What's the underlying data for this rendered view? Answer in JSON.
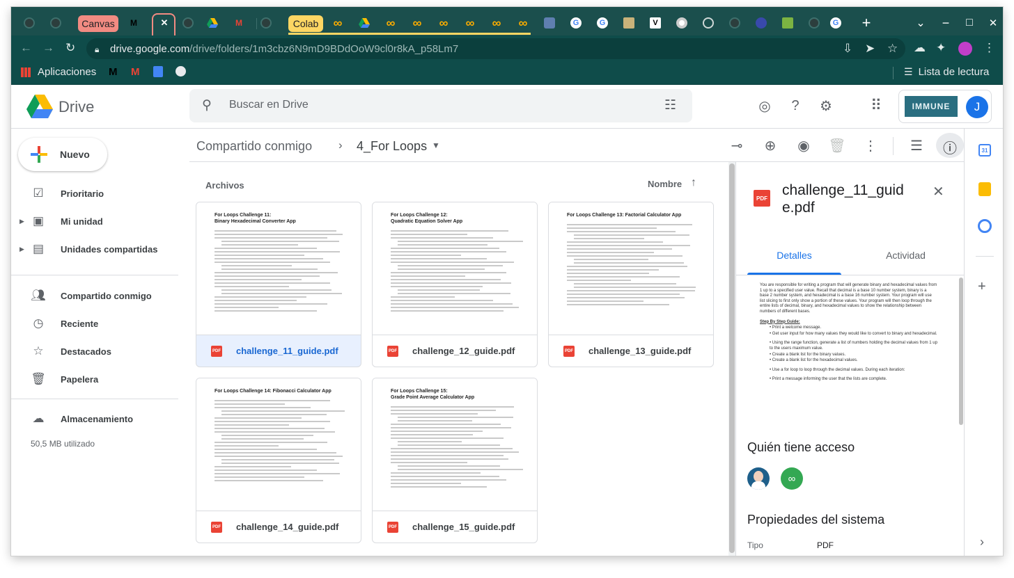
{
  "tabs": {
    "canvas_label": "Canvas",
    "colab_label": "Colab",
    "new_tab": "+",
    "menu": "⌄",
    "minimize": "−",
    "maximize": "□",
    "close": "✕"
  },
  "toolbar": {
    "url_host": "drive.google.com",
    "url_path": "/drive/folders/1m3cbz6N9mD9BDdOoW9cl0r8kA_p58Lm7"
  },
  "bookmarks": {
    "apps_label": "Aplicaciones",
    "reading_list": "Lista de lectura"
  },
  "drive": {
    "logo_text": "Drive",
    "search_placeholder": "Buscar en Drive",
    "avatar_letter": "J",
    "org_logo_text": "IMMUNE"
  },
  "sidebar": {
    "new_button": "Nuevo",
    "items": [
      {
        "label": "Prioritario"
      },
      {
        "label": "Mi unidad"
      },
      {
        "label": "Unidades compartidas"
      },
      {
        "label": "Compartido conmigo"
      },
      {
        "label": "Reciente"
      },
      {
        "label": "Destacados"
      },
      {
        "label": "Papelera"
      },
      {
        "label": "Almacenamiento"
      }
    ],
    "storage_used": "50,5 MB utilizado"
  },
  "breadcrumb": {
    "parent": "Compartido conmigo",
    "current": "4_For Loops"
  },
  "files": {
    "section_label": "Archivos",
    "sort_label": "Nombre",
    "items": [
      {
        "name": "challenge_11_guide.pdf",
        "title1": "For Loops Challenge 11:",
        "title2": "Binary Hexadecimal Converter App"
      },
      {
        "name": "challenge_12_guide.pdf",
        "title1": "For Loops Challenge 12:",
        "title2": "Quadratic Equation Solver App"
      },
      {
        "name": "challenge_13_guide.pdf",
        "title1": "For Loops Challenge 13: Factorial Calculator App",
        "title2": ""
      },
      {
        "name": "challenge_14_guide.pdf",
        "title1": "For Loops Challenge 14: Fibonacci Calculator App",
        "title2": ""
      },
      {
        "name": "challenge_15_guide.pdf",
        "title1": "For Loops Challenge 15:",
        "title2": "Grade Point Average Calculator App"
      }
    ]
  },
  "pdf_badge": "PDF",
  "details": {
    "title": "challenge_11_guide.pdf",
    "tab_details": "Detalles",
    "tab_activity": "Actividad",
    "access_heading": "Quién tiene acceso",
    "system_heading": "Propiedades del sistema",
    "type_label": "Tipo",
    "type_value": "PDF",
    "preview_lines": [
      "You are responsible for writing a program that will generate binary and hexadecimal values from",
      "1 up to a specified user value.  Recall that decimal is a base 10 number system, binary is a",
      "base 2 number system, and hexadecimal is a base 16 number system.  Your program will use",
      "list slicing to first only show a portion of these values.  Your program will then loop through the",
      "entire lists of decimal, binary, and hexadecimal values to show the relationship between",
      "numbers of different bases."
    ],
    "preview_heading": "Step By Step Guide:",
    "preview_bullets": [
      "Print a welcome message.",
      "Get user input for how many values they would like to convert to binary and hexadecimal.",
      "Using the range function, generate a list of numbers holding the decimal values from 1 up to the users maximum value.",
      "Create a blank list for the binary values.",
      "Create a blank list for the hexadecimal values.",
      "Use a for loop to loop through the decimal values.  During each iteration:",
      "Print a message informing the user that the lists are complete."
    ]
  }
}
